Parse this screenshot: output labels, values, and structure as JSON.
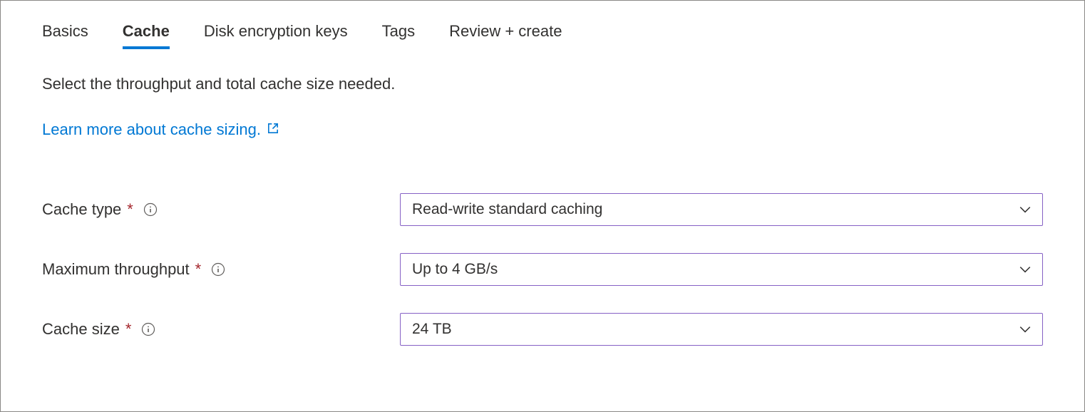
{
  "tabs": {
    "basics": "Basics",
    "cache": "Cache",
    "disk_encryption": "Disk encryption keys",
    "tags": "Tags",
    "review": "Review + create"
  },
  "description": "Select the throughput and total cache size needed.",
  "learn_more": "Learn more about cache sizing.",
  "fields": {
    "cache_type": {
      "label": "Cache type",
      "value": "Read-write standard caching"
    },
    "max_throughput": {
      "label": "Maximum throughput",
      "value": "Up to 4 GB/s"
    },
    "cache_size": {
      "label": "Cache size",
      "value": "24 TB"
    }
  },
  "colors": {
    "link": "#0078d4",
    "select_border": "#8661c5",
    "required": "#a4262c"
  }
}
